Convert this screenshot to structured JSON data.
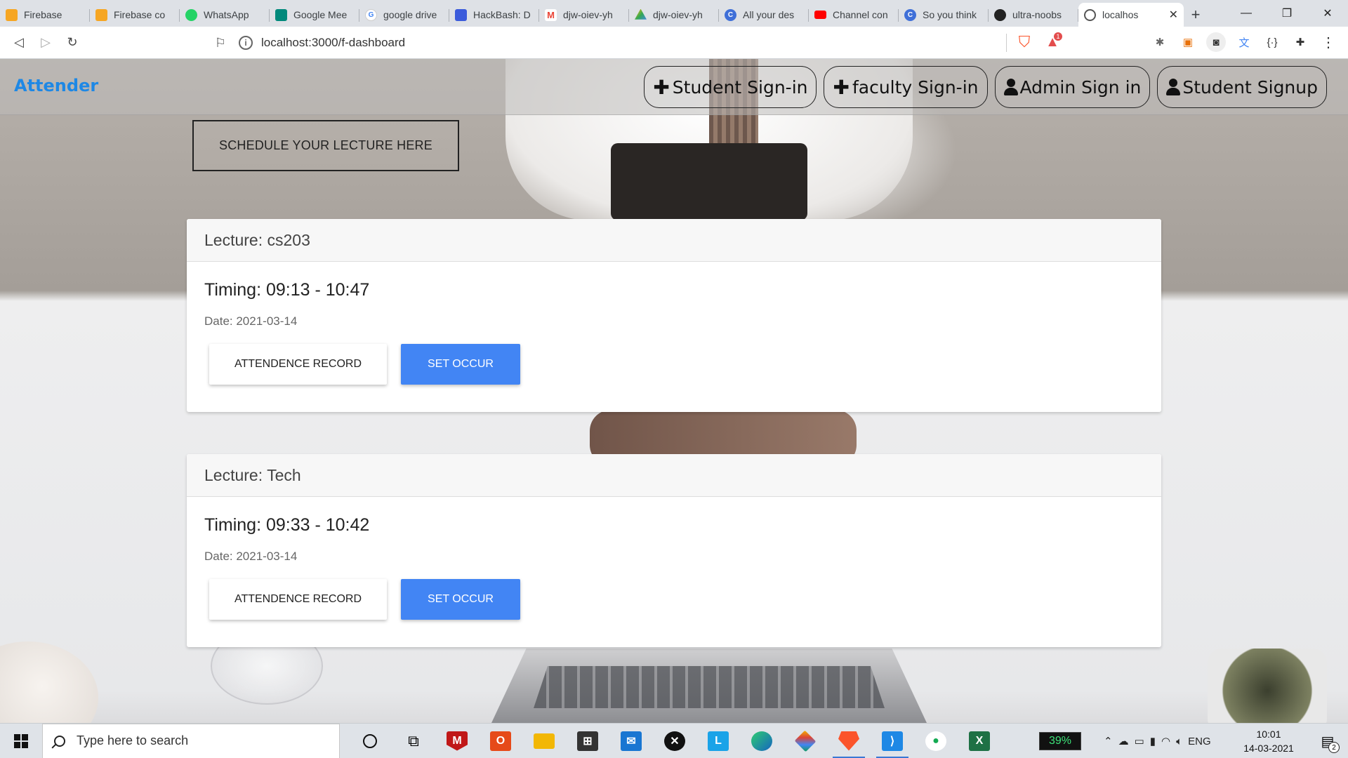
{
  "browser": {
    "tabs": [
      {
        "title": "Firebase",
        "icon": "firebase-icon",
        "color": "#f6a623",
        "glyph": ""
      },
      {
        "title": "Firebase co",
        "icon": "firebase-icon",
        "color": "#f6a623",
        "glyph": ""
      },
      {
        "title": "WhatsApp",
        "icon": "whatsapp-icon",
        "color": "#25d366",
        "glyph": ""
      },
      {
        "title": "Google Mee",
        "icon": "google-meet-icon",
        "color": "#00897b",
        "glyph": ""
      },
      {
        "title": "google drive",
        "icon": "google-icon",
        "color": "#4285f4",
        "glyph": "G"
      },
      {
        "title": "HackBash: D",
        "icon": "hackbash-icon",
        "color": "#3b5bdb",
        "glyph": ""
      },
      {
        "title": "djw-oiev-yh",
        "icon": "gmail-icon",
        "color": "#ea4335",
        "glyph": "M"
      },
      {
        "title": "djw-oiev-yh",
        "icon": "google-drive-icon",
        "color": "#34a853",
        "glyph": ""
      },
      {
        "title": "All your des",
        "icon": "c-icon",
        "color": "#3f6fd8",
        "glyph": "C"
      },
      {
        "title": "Channel con",
        "icon": "youtube-icon",
        "color": "#ff0000",
        "glyph": ""
      },
      {
        "title": "So you think",
        "icon": "c-icon",
        "color": "#3f6fd8",
        "glyph": "C"
      },
      {
        "title": "ultra-noobs",
        "icon": "github-icon",
        "color": "#222222",
        "glyph": ""
      }
    ],
    "active_tab": {
      "title": "localhos",
      "icon": "globe-icon"
    },
    "url": "localhost:3000/f-dashboard",
    "brave_badge": "1"
  },
  "navbar": {
    "brand": "Attender",
    "links": [
      {
        "label": "Student Sign-in",
        "icon": "plus-icon"
      },
      {
        "label": "faculty Sign-in",
        "icon": "plus-icon"
      },
      {
        "label": "Admin Sign in",
        "icon": "person-icon"
      },
      {
        "label": "Student Signup",
        "icon": "person-icon"
      }
    ]
  },
  "schedule_button": "SCHEDULE YOUR LECTURE HERE",
  "lectures": [
    {
      "title": "Lecture: cs203",
      "timing": "Timing: 09:13 - 10:47",
      "date": "Date: 2021-03-14",
      "record_label": "ATTENDENCE RECORD",
      "occur_label": "SET OCCUR"
    },
    {
      "title": "Lecture: Tech",
      "timing": "Timing: 09:33 - 10:42",
      "date": "Date: 2021-03-14",
      "record_label": "ATTENDENCE RECORD",
      "occur_label": "SET OCCUR"
    }
  ],
  "taskbar": {
    "search_placeholder": "Type here to search",
    "battery": "39%",
    "language": "ENG",
    "time": "10:01",
    "date": "14-03-2021",
    "notifications": "2"
  },
  "colors": {
    "brand": "#1e88e5",
    "primary_button": "#4285f4"
  }
}
